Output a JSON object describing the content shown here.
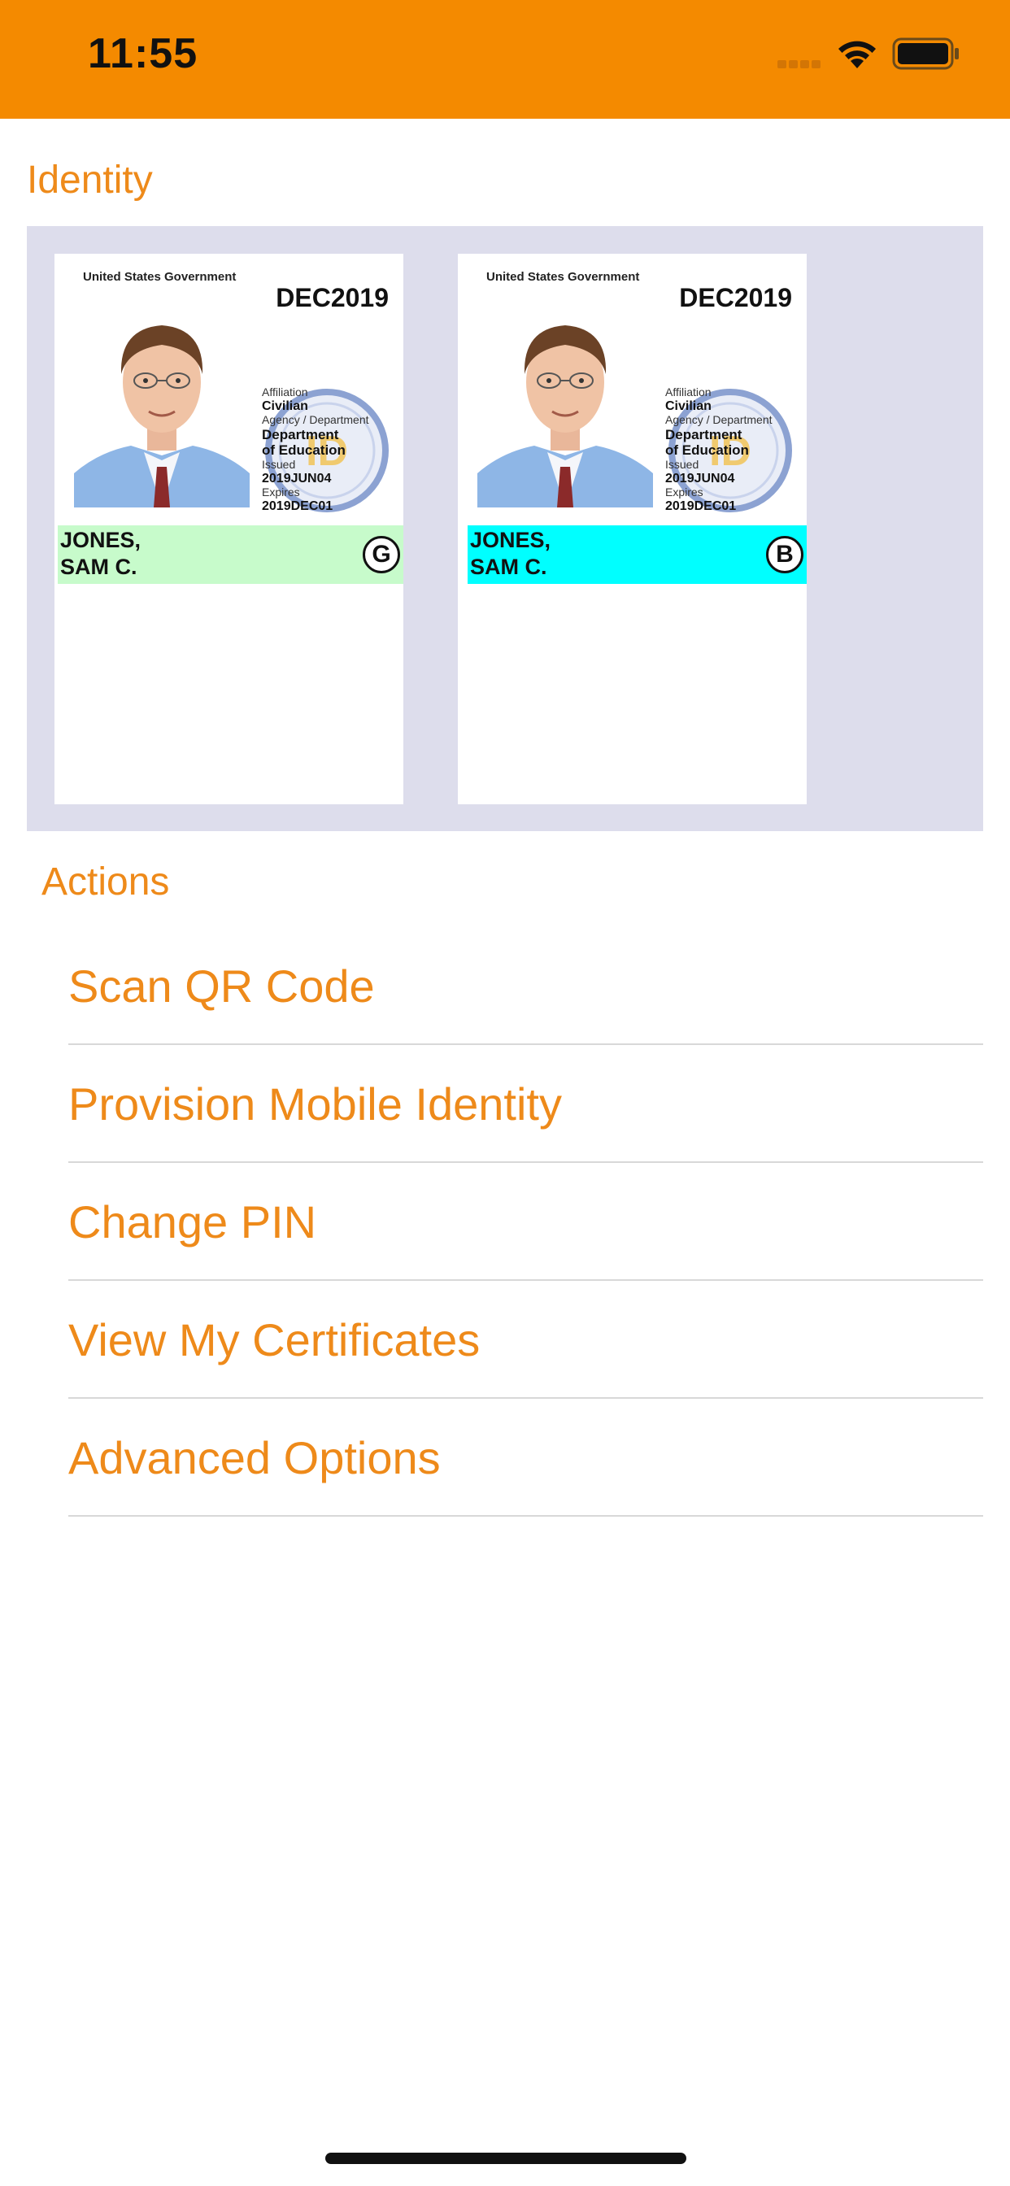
{
  "status_bar": {
    "time": "11:55",
    "background_color": "#F48A00",
    "icons": [
      "signal-icon",
      "wifi-icon",
      "battery-icon"
    ]
  },
  "identity": {
    "header": "Identity",
    "panel_color": "#DDDDEC",
    "cards": [
      {
        "government": "United States Government",
        "date": "DEC2019",
        "affiliation_label": "Affiliation",
        "affiliation": "Civilian",
        "agency_label": "Agency / Department",
        "agency_line1": "Department",
        "agency_line2": "of Education",
        "issued_label": "Issued",
        "issued": "2019JUN04",
        "expires_label": "Expires",
        "expires": "2019DEC01",
        "name_line1": "JONES,",
        "name_line2": "SAM C.",
        "badge": "G",
        "bar_color": "#C7FBCB"
      },
      {
        "government": "United States Government",
        "date": "DEC2019",
        "affiliation_label": "Affiliation",
        "affiliation": "Civilian",
        "agency_label": "Agency / Department",
        "agency_line1": "Department",
        "agency_line2": "of Education",
        "issued_label": "Issued",
        "issued": "2019JUN04",
        "expires_label": "Expires",
        "expires": "2019DEC01",
        "name_line1": "JONES,",
        "name_line2": "SAM C.",
        "badge": "B",
        "bar_color": "#00FFFF"
      }
    ]
  },
  "actions": {
    "header": "Actions",
    "accent_color": "#EE8A1A",
    "items": [
      {
        "label": "Scan QR Code"
      },
      {
        "label": "Provision Mobile Identity"
      },
      {
        "label": "Change PIN"
      },
      {
        "label": "View My Certificates"
      },
      {
        "label": "Advanced Options"
      }
    ]
  }
}
